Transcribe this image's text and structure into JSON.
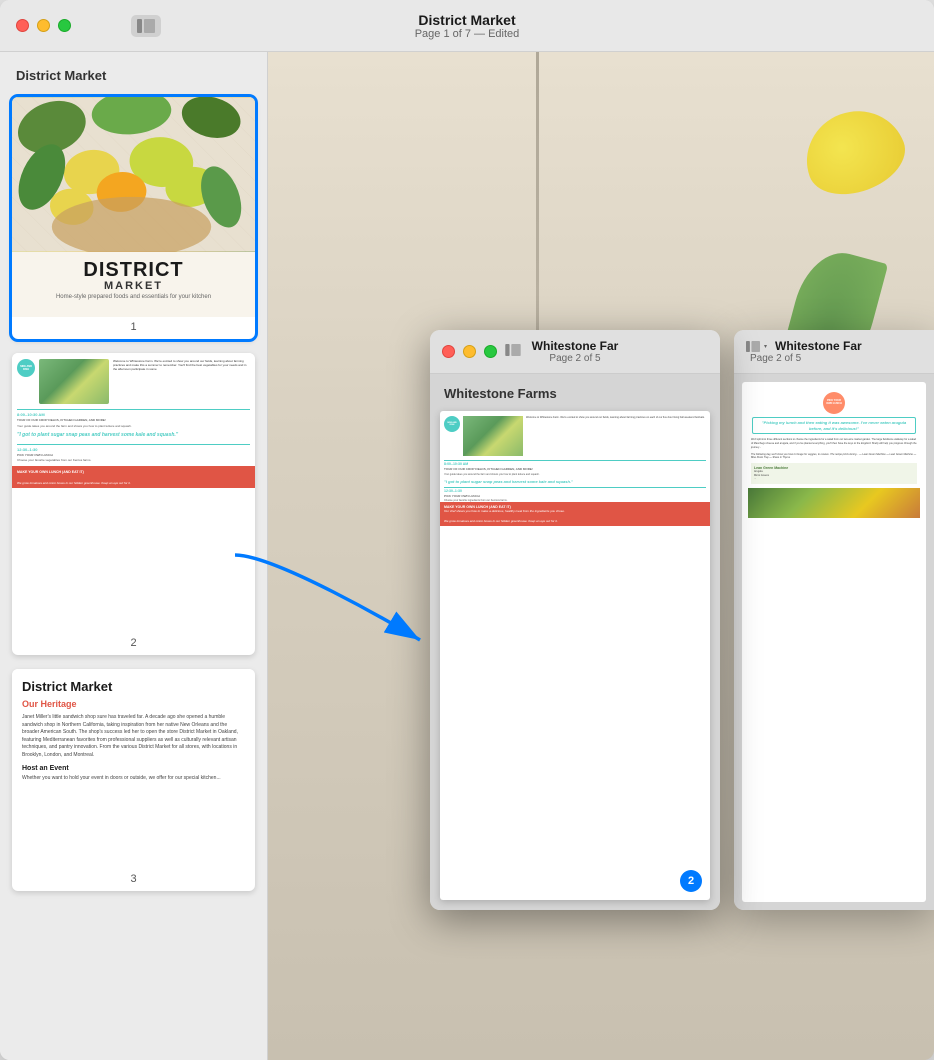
{
  "mainWindow": {
    "title": "District Market",
    "subtitle": "Page 1 of 7 — Edited",
    "trafficLights": {
      "red": "close",
      "yellow": "minimize",
      "green": "maximize"
    },
    "panelToggleLabel": "panel-toggle"
  },
  "sidebar": {
    "title": "District Market",
    "pages": [
      {
        "number": "1",
        "label": "1"
      },
      {
        "number": "2",
        "label": "2"
      },
      {
        "number": "3",
        "label": "3"
      }
    ]
  },
  "coverPage": {
    "title": "DISTRICT",
    "subtitle": "MARKET",
    "tagline": "Home-style prepared foods and essentials for your kitchen"
  },
  "page2": {
    "timeSlot1": "8:00–10:30 AM",
    "timeSlot1Label": "TOUR OF OUR CROP FIELDS, KITCHEN GARDEN, AND MORE!",
    "quote": "\"I got to plant sugar snap peas and harvest some kale and squash.\"",
    "timeSlot2": "12:30–1:30",
    "timeSlot2Label": "PICK YOUR OWN LUNCH",
    "timeSlot3": "1:30–1:15",
    "timeSlot3Label": "MAKE YOUR OWN LUNCH (AND EAT IT)",
    "bottomText": "We grow tomatoes and onion boxes in our hidden greenhouse. Keep an eye out for it."
  },
  "secondWindow": {
    "title": "Whitestone Far",
    "subtitle": "Page 2 of 5",
    "pageBadge": "2"
  },
  "thirdWindow": {
    "title": "Whitestone Far",
    "subtitle": "Page 2 of 5"
  },
  "blueArrow": {
    "description": "curved arrow pointing from sidebar page 2 to floating window page 2"
  }
}
